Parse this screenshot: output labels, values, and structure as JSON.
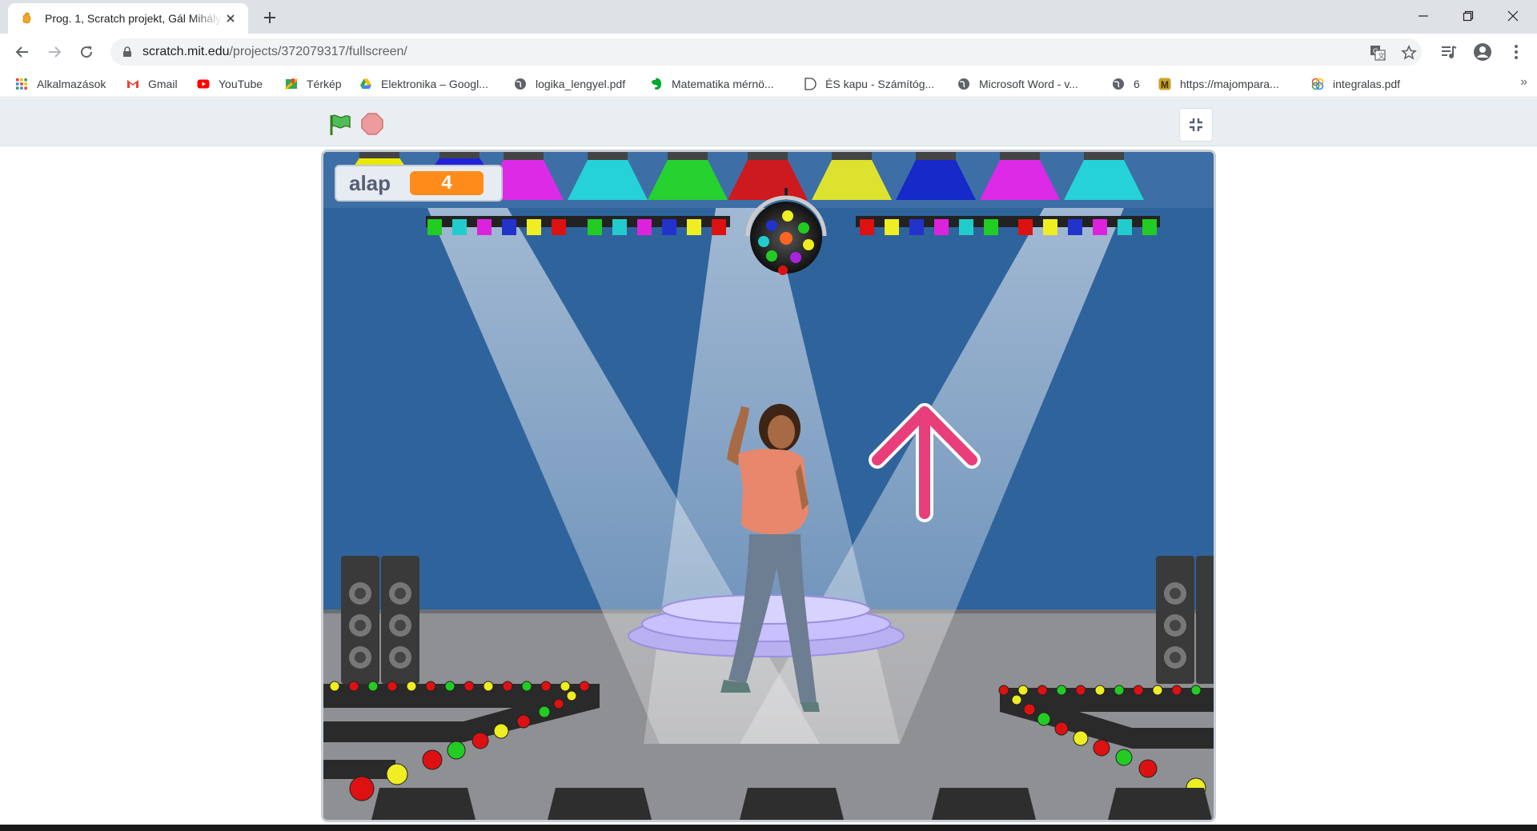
{
  "browser": {
    "tab_title": "Prog. 1, Scratch projekt, Gál Mihály",
    "url_host": "scratch.mit.edu",
    "url_path": "/projects/372079317/fullscreen/"
  },
  "bookmarks": [
    {
      "label": "Alkalmazások",
      "icon": "apps-grid-icon"
    },
    {
      "label": "Gmail",
      "icon": "gmail-icon"
    },
    {
      "label": "YouTube",
      "icon": "youtube-icon"
    },
    {
      "label": "Térkép",
      "icon": "maps-icon"
    },
    {
      "label": "Elektronika – Googl...",
      "icon": "drive-icon"
    },
    {
      "label": "logika_lengyel.pdf",
      "icon": "globe-icon"
    },
    {
      "label": "Matematika mérnö...",
      "icon": "evernote-icon"
    },
    {
      "label": "ÉS kapu - Számítóg...",
      "icon": "gate-icon"
    },
    {
      "label": "Microsoft Word - v...",
      "icon": "globe-icon"
    },
    {
      "label": "6",
      "icon": "globe-icon"
    },
    {
      "label": "https://majompara...",
      "icon": "majom-icon"
    },
    {
      "label": "integralas.pdf",
      "icon": "rings-icon"
    }
  ],
  "bookmarks_more": "»",
  "player": {
    "monitor_label": "alap",
    "monitor_value": "4"
  },
  "colors": {
    "scratch_orange": "#ff8c1a",
    "stage_blue": "#2f639c",
    "arrow_pink": "#e83e7a"
  }
}
